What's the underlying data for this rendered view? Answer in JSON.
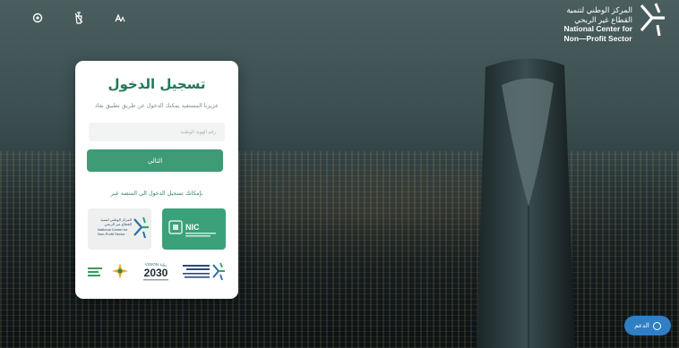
{
  "header": {
    "brand_ar_line1": "المركز الوطني لتنمية",
    "brand_ar_line2": "القطاع غير الربحي",
    "brand_en_line1": "National Center for",
    "brand_en_line2": "Non—Profit Sector",
    "icons": [
      "accessibility-icon",
      "color-contrast-icon",
      "font-size-icon"
    ]
  },
  "login": {
    "title": "تسجيل الدخول",
    "subtitle": "عزيزنا المستفيد يمكنك الدخول عن طريق تطبيق نفاذ",
    "id_placeholder": "رقم الهوية الوطنية",
    "next_label": "التالي",
    "platform_text": "بإمكانك تسجيل الدخول الى المنصة عبر"
  },
  "logos": {
    "nic": "NIC",
    "ncnp_ar1": "المركز الوطني لتنمية",
    "ncnp_ar2": "القطاع غير الربحي",
    "ncnp_en1": "National Center for",
    "ncnp_en2": "Non-Profit Sector",
    "vision_top": "VISION رؤية",
    "vision_year": "2030"
  },
  "support": {
    "label": "الدعم"
  },
  "colors": {
    "primary": "#3f9a76",
    "title": "#1f7a55",
    "support": "#2f7fc4"
  }
}
